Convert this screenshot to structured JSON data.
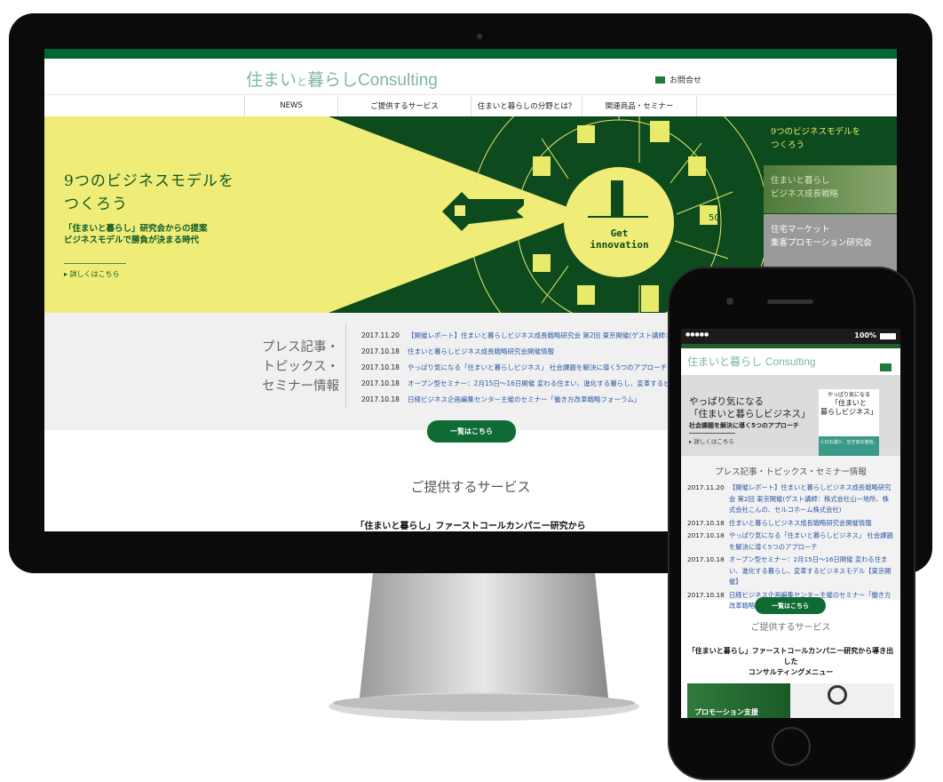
{
  "desktop": {
    "logo": {
      "main": "住まい",
      "small": "と",
      "rest": "暮らし",
      "latin": "Consulting"
    },
    "contact_label": "お問合せ",
    "nav": [
      "NEWS",
      "ご提供するサービス",
      "住まいと暮らしの分野とは？",
      "関連商品・セミナー"
    ],
    "hero": {
      "title_line1": "9つのビジネスモデルを",
      "title_line2": "つくろう",
      "sub_line1": "「住まいと暮らし」研究会からの提案",
      "sub_line2": "ビジネスモデルで勝負が決まる時代",
      "more": "詳しくはこちら",
      "center_line1": "Get",
      "center_line2": "innovation",
      "badge": "50"
    },
    "side_tiles": [
      {
        "line1": "9つのビジネスモデルを",
        "line2": "つくろう"
      },
      {
        "line1": "住まいと暮らし",
        "line2": "ビジネス成長戦略"
      },
      {
        "line1": "住宅マーケット",
        "line2": "集客プロモーション研究会"
      }
    ],
    "news": {
      "title_line1": "プレス記事・",
      "title_line2": "トピックス・",
      "title_line3": "セミナー情報",
      "items": [
        {
          "date": "2017.11.20",
          "text": "【開催レポート】住まいと暮らしビジネス成長戦略研究会 第2回 東京開催(ゲスト講師：株式会"
        },
        {
          "date": "2017.10.18",
          "text": "住まいと暮らしビジネス成長戦略研究会開催情報"
        },
        {
          "date": "2017.10.18",
          "text": "やっぱり気になる「住まいと暮らしビジネス」 社会課題を解決に導く5つのアプローチ"
        },
        {
          "date": "2017.10.18",
          "text": "オープン型セミナー：2月15日〜16日開催 変わる住まい、進化する暮らし、変革するビジネスモデル"
        },
        {
          "date": "2017.10.18",
          "text": "日経ビジネス企画編集センター主催のセミナー「働き方改革戦略フォーラム」"
        }
      ],
      "button": "一覧はこちら"
    },
    "services_title": "ご提供するサービス",
    "services_sub": "「住まいと暮らし」ファーストコールカンパニー研究から"
  },
  "phone": {
    "carrier": "●●●●● ",
    "battery": "100%",
    "logo": "住まいと暮らし",
    "logo_latin": "Consulting",
    "hero": {
      "line1": "やっぱり気になる",
      "line2": "「住まいと暮らしビジネス」",
      "line3": "社会課題を解決に導く5つのアプローチ",
      "more": "詳しくはこちら",
      "book_title1": "やっぱり気になる",
      "book_title2": "「住まいと",
      "book_title3": "暮らしビジネス」",
      "book_caption": "人口の減少、空き家の増加。"
    },
    "news_title": "プレス記事・トピックス・セミナー情報",
    "news": [
      {
        "date": "2017.11.20",
        "text": "【開催レポート】住まいと暮らしビジネス成長戦略研究会 第2回 東京開催(ゲスト講師：株式会社山一地所、株式会社こんの、セルコホーム株式会社)"
      },
      {
        "date": "2017.10.18",
        "text": "住まいと暮らしビジネス成長戦略研究会開催情報"
      },
      {
        "date": "2017.10.18",
        "text": "やっぱり気になる「住まいと暮らしビジネス」 社会課題を解決に導く5つのアプローチ"
      },
      {
        "date": "2017.10.18",
        "text": "オープン型セミナー：2月15日〜16日開催 変わる住まい、進化する暮らし、変革するビジネスモデル【東京開催】"
      },
      {
        "date": "2017.10.18",
        "text": "日経ビジネス企画編集センター主催のセミナー「働き方改革戦略フォーラム」"
      }
    ],
    "button": "一覧はこちら",
    "services_title": "ご提供するサービス",
    "services_sub1": "「住まいと暮らし」ファーストコールカンパニー研究から導き出した",
    "services_sub2": "コンサルティングメニュー",
    "tile_label": "プロモーション支援"
  },
  "colors": {
    "brand_green": "#006633",
    "dark_green": "#0d4a1e",
    "yellow": "#f0ec78",
    "link": "#2a57a6"
  }
}
